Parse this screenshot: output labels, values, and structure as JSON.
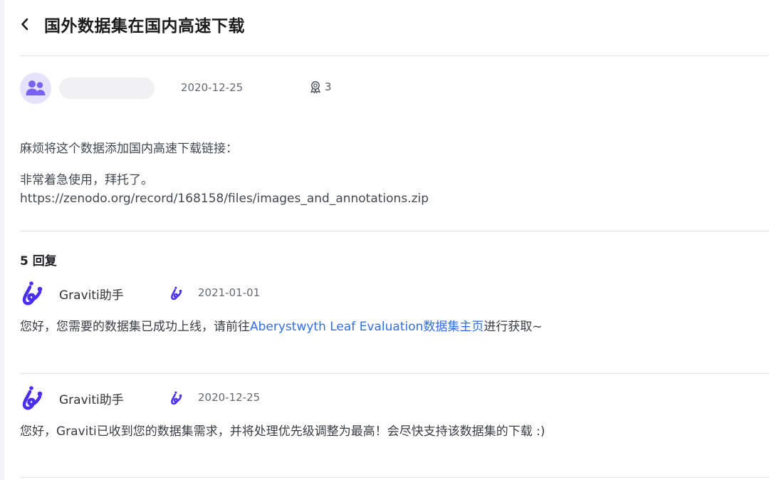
{
  "header": {
    "title": "国外数据集在国内高速下载"
  },
  "post": {
    "date": "2020-12-25",
    "like_count": "3",
    "line1": "麻烦将这个数据添加国内高速下载链接：",
    "line2": "非常着急使用，拜托了。",
    "line3": "https://zenodo.org/record/168158/files/images_and_annotations.zip"
  },
  "replies_header": {
    "count_label": "5 回复"
  },
  "replies": [
    {
      "author": "Graviti助手",
      "date": "2021-01-01",
      "text_before": "您好，您需要的数据集已成功上线，请前往",
      "link_text": "Aberystwyth Leaf Evaluation数据集主页",
      "text_after": "进行获取~"
    },
    {
      "author": "Graviti助手",
      "date": "2020-12-25",
      "text": "您好，Graviti已收到您的数据集需求，并将处理优先级调整为最高！会尽快支持该数据集的下载 :)"
    }
  ],
  "colors": {
    "brand": "#4a2ff0",
    "avatar_bg": "#e6e2fb",
    "avatar_fg": "#7b62ec",
    "link": "#2f6ee5",
    "divider": "#e4e4e8"
  },
  "icons": {
    "back": "chevron-left-icon",
    "like": "award-icon",
    "avatar": "users-icon",
    "brand": "graviti-logo-icon"
  }
}
